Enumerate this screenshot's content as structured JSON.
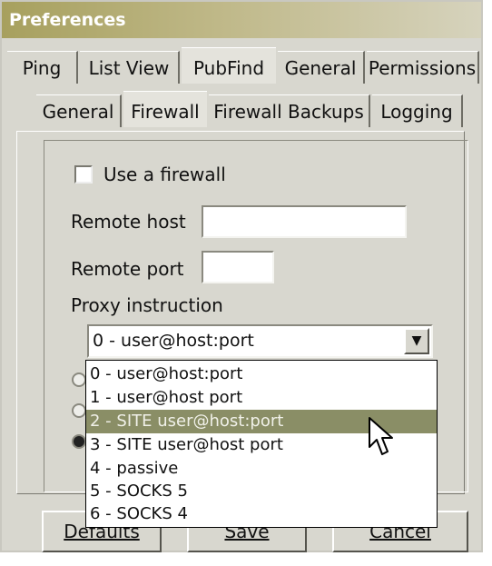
{
  "window": {
    "title": "Preferences"
  },
  "tabs_top": [
    "Ping",
    "List View",
    "PubFind",
    "General",
    "Permissions"
  ],
  "tabs_sub": [
    "General",
    "Firewall",
    "Firewall Backups",
    "Logging"
  ],
  "firewall": {
    "use_firewall_label": "Use a firewall",
    "remote_host_label": "Remote host",
    "remote_host_value": "",
    "remote_port_label": "Remote port",
    "remote_port_value": "",
    "proxy_instruction_label": "Proxy instruction",
    "proxy_selected": "0 - user@host:port",
    "proxy_options": [
      "0 - user@host:port",
      "1 - user@host port",
      "2 - SITE user@host:port",
      "3 - SITE user@host port",
      "4 - passive",
      "5 - SOCKS 5",
      "6 - SOCKS 4"
    ]
  },
  "buttons": {
    "defaults": "Defaults",
    "save": "Save",
    "cancel": "Cancel"
  },
  "icons": {
    "dropdown_arrow": "chevron-down-icon",
    "cursor": "mouse-pointer-icon"
  },
  "colors": {
    "highlight": "#8a8e66",
    "title_bar": "#a7a05e"
  }
}
